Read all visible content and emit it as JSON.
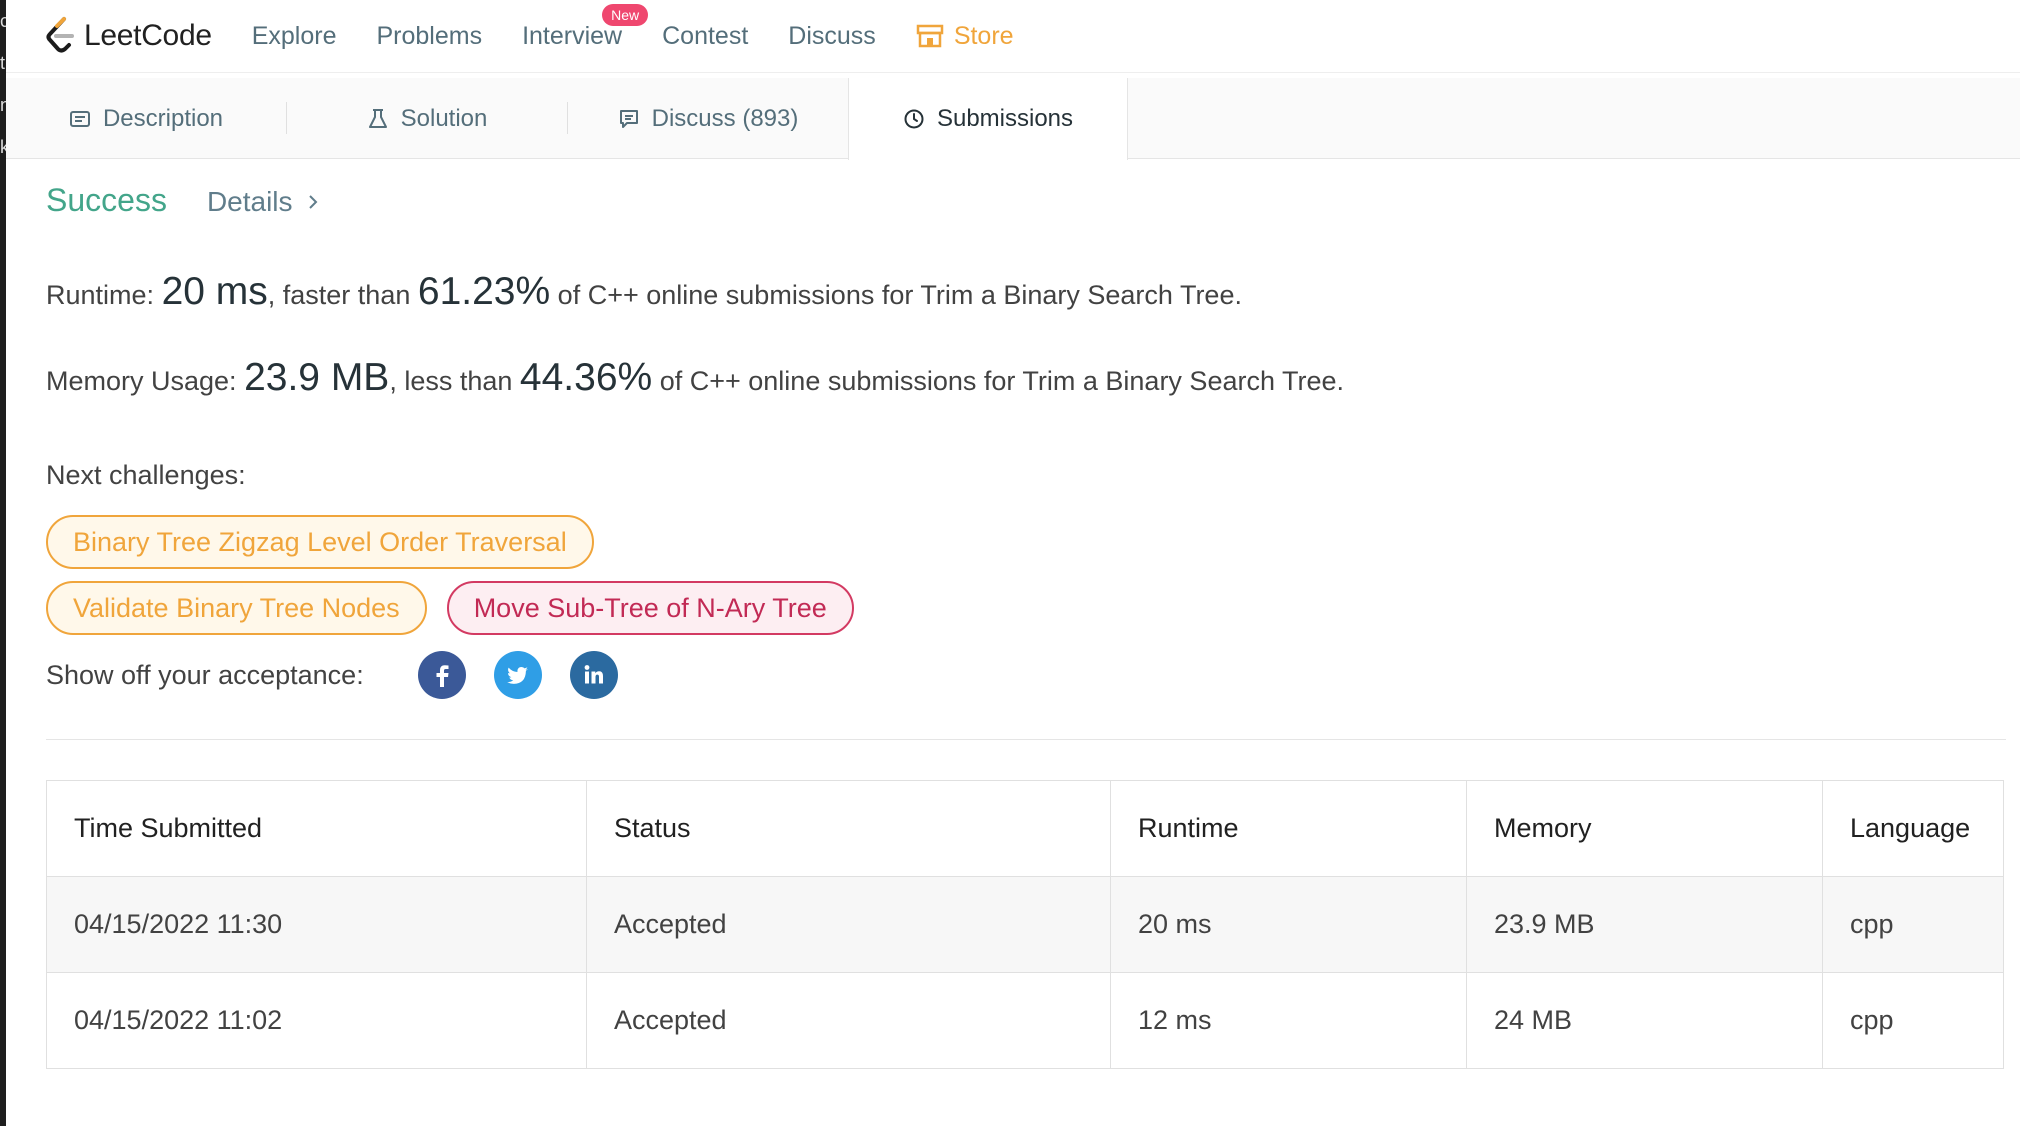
{
  "nav": {
    "logo_text": "LeetCode",
    "items": [
      "Explore",
      "Problems",
      "Interview",
      "Contest",
      "Discuss"
    ],
    "interview_badge": "New",
    "store": "Store"
  },
  "tabs": {
    "description": "Description",
    "solution": "Solution",
    "discuss": "Discuss (893)",
    "submissions": "Submissions"
  },
  "result": {
    "status": "Success",
    "details": "Details",
    "runtime_label": "Runtime:",
    "runtime_value": "20 ms",
    "runtime_mid": ", faster than",
    "runtime_pct": "61.23%",
    "runtime_tail": "of C++ online submissions for Trim a Binary Search Tree.",
    "memory_label": "Memory Usage:",
    "memory_value": "23.9 MB",
    "memory_mid": ", less than",
    "memory_pct": "44.36%",
    "memory_tail": "of C++ online submissions for Trim a Binary Search Tree."
  },
  "next": {
    "label": "Next challenges:",
    "challenges": [
      "Binary Tree Zigzag Level Order Traversal",
      "Validate Binary Tree Nodes",
      "Move Sub-Tree of N-Ary Tree"
    ]
  },
  "share": {
    "label": "Show off your acceptance:"
  },
  "table": {
    "headers": [
      "Time Submitted",
      "Status",
      "Runtime",
      "Memory",
      "Language"
    ],
    "rows": [
      [
        "04/15/2022 11:30",
        "Accepted",
        "20 ms",
        "23.9 MB",
        "cpp"
      ],
      [
        "04/15/2022 11:02",
        "Accepted",
        "12 ms",
        "24 MB",
        "cpp"
      ]
    ]
  },
  "colors": {
    "success": "#43a58a",
    "medium": "#f0a53b",
    "hard": "#c22a55",
    "badge": "#ef476f"
  }
}
